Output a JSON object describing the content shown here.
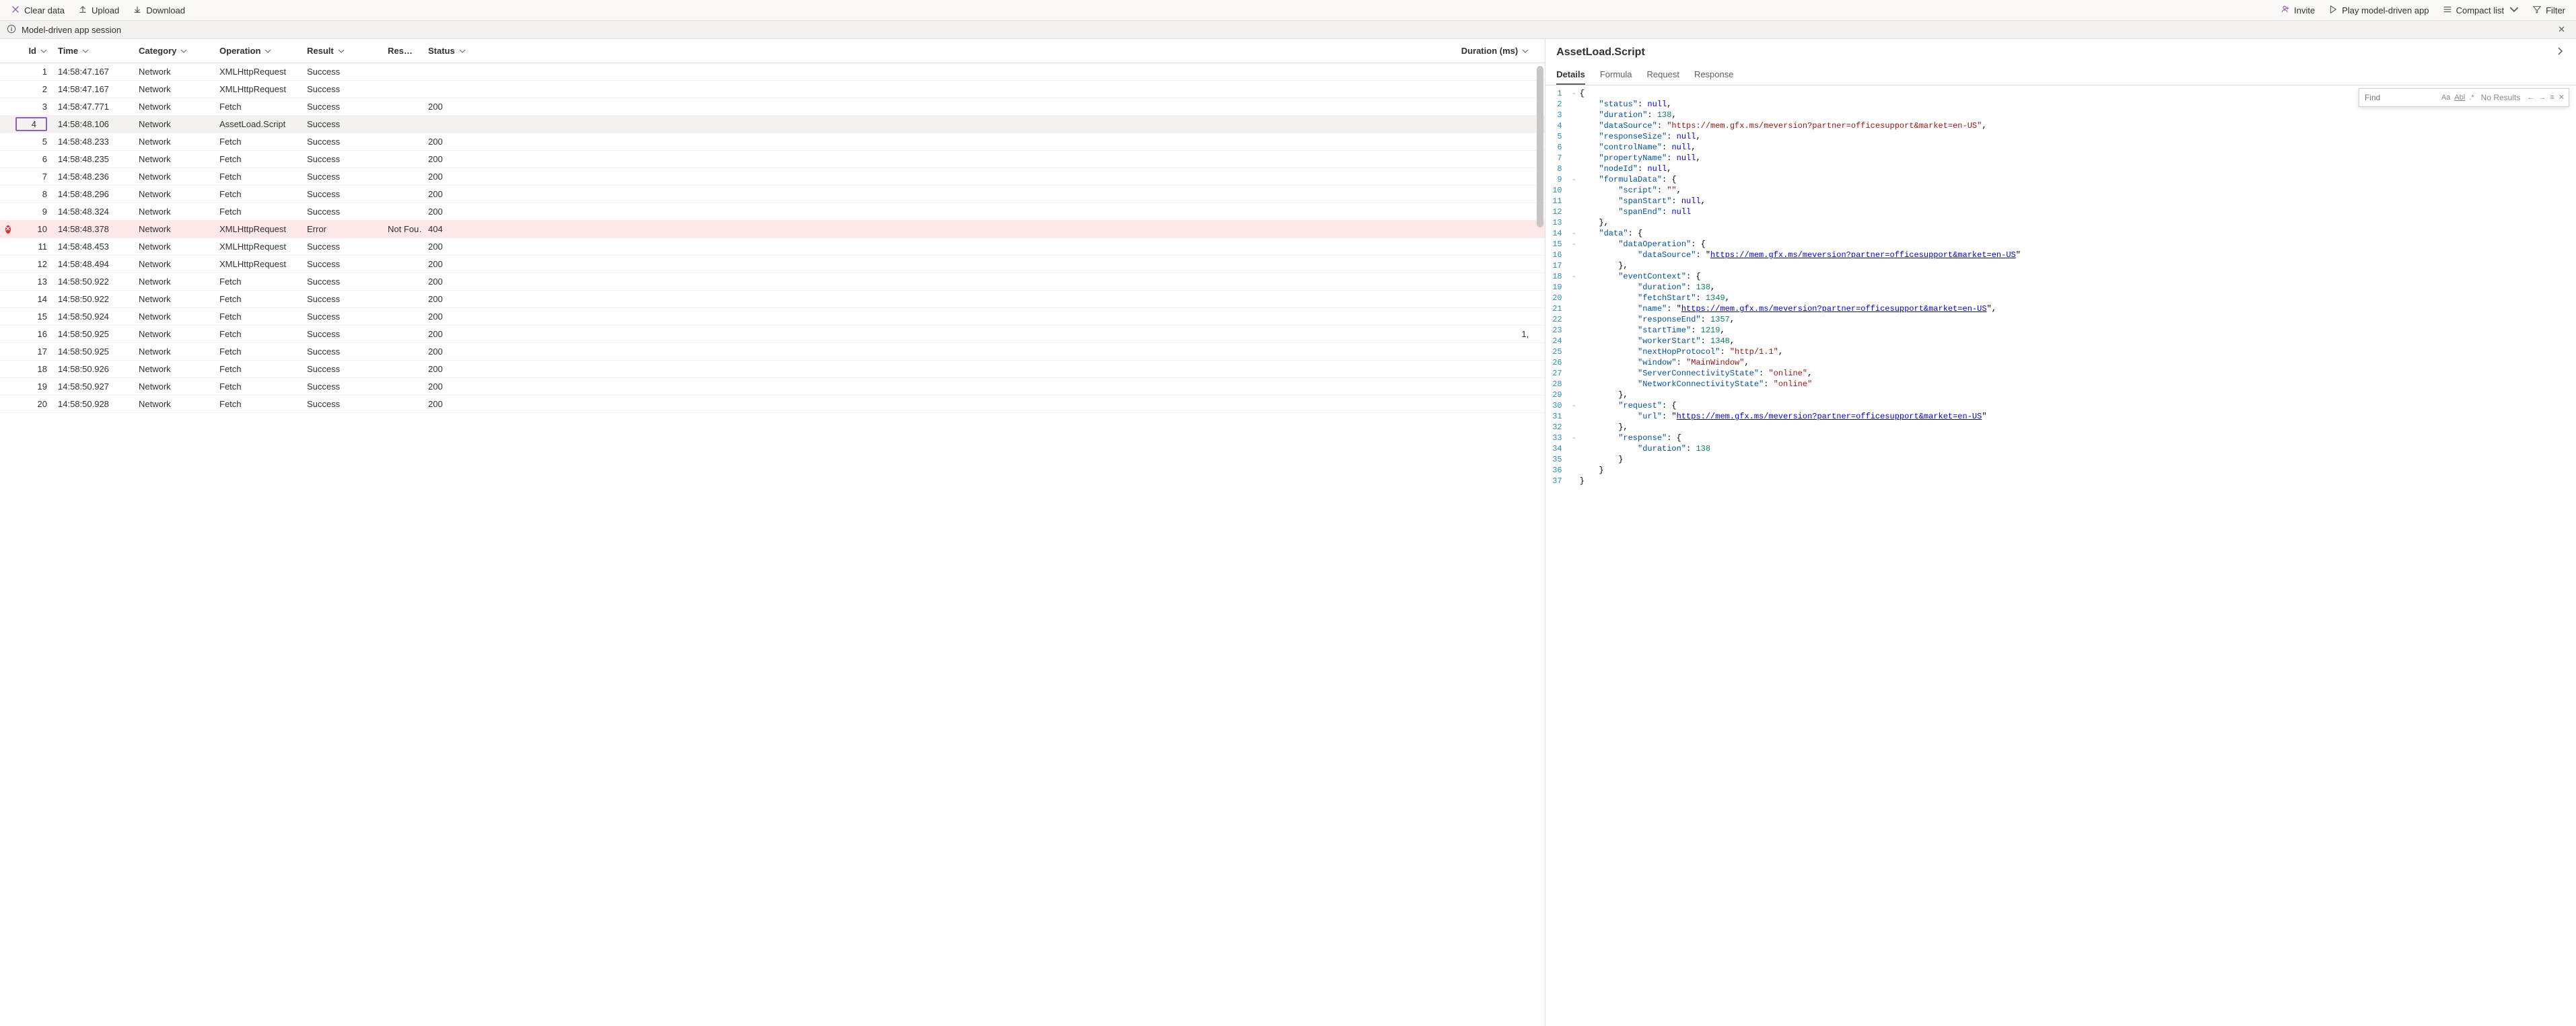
{
  "toolbar": {
    "clear": "Clear data",
    "upload": "Upload",
    "download": "Download",
    "invite": "Invite",
    "play": "Play model-driven app",
    "compact": "Compact list",
    "filter": "Filter"
  },
  "session": {
    "title": "Model-driven app session"
  },
  "columns": {
    "id": "Id",
    "time": "Time",
    "category": "Category",
    "operation": "Operation",
    "result": "Result",
    "res2": "Res…",
    "status": "Status",
    "duration": "Duration (ms)"
  },
  "rows": [
    {
      "id": "1",
      "time": "14:58:47.167",
      "cat": "Network",
      "op": "XMLHttpRequest",
      "res": "Success",
      "res2": "",
      "status": "",
      "dur": "",
      "err": false,
      "sel": false
    },
    {
      "id": "2",
      "time": "14:58:47.167",
      "cat": "Network",
      "op": "XMLHttpRequest",
      "res": "Success",
      "res2": "",
      "status": "",
      "dur": "",
      "err": false,
      "sel": false
    },
    {
      "id": "3",
      "time": "14:58:47.771",
      "cat": "Network",
      "op": "Fetch",
      "res": "Success",
      "res2": "",
      "status": "200",
      "dur": "",
      "err": false,
      "sel": false
    },
    {
      "id": "4",
      "time": "14:58:48.106",
      "cat": "Network",
      "op": "AssetLoad.Script",
      "res": "Success",
      "res2": "",
      "status": "",
      "dur": "",
      "err": false,
      "sel": true
    },
    {
      "id": "5",
      "time": "14:58:48.233",
      "cat": "Network",
      "op": "Fetch",
      "res": "Success",
      "res2": "",
      "status": "200",
      "dur": "",
      "err": false,
      "sel": false
    },
    {
      "id": "6",
      "time": "14:58:48.235",
      "cat": "Network",
      "op": "Fetch",
      "res": "Success",
      "res2": "",
      "status": "200",
      "dur": "",
      "err": false,
      "sel": false
    },
    {
      "id": "7",
      "time": "14:58:48.236",
      "cat": "Network",
      "op": "Fetch",
      "res": "Success",
      "res2": "",
      "status": "200",
      "dur": "",
      "err": false,
      "sel": false
    },
    {
      "id": "8",
      "time": "14:58:48.296",
      "cat": "Network",
      "op": "Fetch",
      "res": "Success",
      "res2": "",
      "status": "200",
      "dur": "",
      "err": false,
      "sel": false
    },
    {
      "id": "9",
      "time": "14:58:48.324",
      "cat": "Network",
      "op": "Fetch",
      "res": "Success",
      "res2": "",
      "status": "200",
      "dur": "",
      "err": false,
      "sel": false
    },
    {
      "id": "10",
      "time": "14:58:48.378",
      "cat": "Network",
      "op": "XMLHttpRequest",
      "res": "Error",
      "res2": "Not Fou…",
      "status": "404",
      "dur": "",
      "err": true,
      "sel": false
    },
    {
      "id": "11",
      "time": "14:58:48.453",
      "cat": "Network",
      "op": "XMLHttpRequest",
      "res": "Success",
      "res2": "",
      "status": "200",
      "dur": "",
      "err": false,
      "sel": false
    },
    {
      "id": "12",
      "time": "14:58:48.494",
      "cat": "Network",
      "op": "XMLHttpRequest",
      "res": "Success",
      "res2": "",
      "status": "200",
      "dur": "",
      "err": false,
      "sel": false
    },
    {
      "id": "13",
      "time": "14:58:50.922",
      "cat": "Network",
      "op": "Fetch",
      "res": "Success",
      "res2": "",
      "status": "200",
      "dur": "",
      "err": false,
      "sel": false
    },
    {
      "id": "14",
      "time": "14:58:50.922",
      "cat": "Network",
      "op": "Fetch",
      "res": "Success",
      "res2": "",
      "status": "200",
      "dur": "",
      "err": false,
      "sel": false
    },
    {
      "id": "15",
      "time": "14:58:50.924",
      "cat": "Network",
      "op": "Fetch",
      "res": "Success",
      "res2": "",
      "status": "200",
      "dur": "",
      "err": false,
      "sel": false
    },
    {
      "id": "16",
      "time": "14:58:50.925",
      "cat": "Network",
      "op": "Fetch",
      "res": "Success",
      "res2": "",
      "status": "200",
      "dur": "1,",
      "err": false,
      "sel": false
    },
    {
      "id": "17",
      "time": "14:58:50.925",
      "cat": "Network",
      "op": "Fetch",
      "res": "Success",
      "res2": "",
      "status": "200",
      "dur": "",
      "err": false,
      "sel": false
    },
    {
      "id": "18",
      "time": "14:58:50.926",
      "cat": "Network",
      "op": "Fetch",
      "res": "Success",
      "res2": "",
      "status": "200",
      "dur": "",
      "err": false,
      "sel": false
    },
    {
      "id": "19",
      "time": "14:58:50.927",
      "cat": "Network",
      "op": "Fetch",
      "res": "Success",
      "res2": "",
      "status": "200",
      "dur": "",
      "err": false,
      "sel": false
    },
    {
      "id": "20",
      "time": "14:58:50.928",
      "cat": "Network",
      "op": "Fetch",
      "res": "Success",
      "res2": "",
      "status": "200",
      "dur": "",
      "err": false,
      "sel": false
    }
  ],
  "detail": {
    "title": "AssetLoad.Script",
    "tabs": [
      "Details",
      "Formula",
      "Request",
      "Response"
    ],
    "activeTab": 0
  },
  "find": {
    "placeholder": "Find",
    "result": "No Results"
  },
  "code": {
    "lines": 37,
    "folds": {
      "1": "-",
      "9": "-",
      "14": "-",
      "15": "-",
      "18": "-",
      "30": "-",
      "33": "-"
    },
    "tokens": [
      [
        [
          "punc",
          "{"
        ]
      ],
      [
        [
          "sp",
          "    "
        ],
        [
          "key",
          "\"status\""
        ],
        [
          "punc",
          ": "
        ],
        [
          "null",
          "null"
        ],
        [
          "punc",
          ","
        ]
      ],
      [
        [
          "sp",
          "    "
        ],
        [
          "key",
          "\"duration\""
        ],
        [
          "punc",
          ": "
        ],
        [
          "num",
          "138"
        ],
        [
          "punc",
          ","
        ]
      ],
      [
        [
          "sp",
          "    "
        ],
        [
          "key",
          "\"dataSource\""
        ],
        [
          "punc",
          ": "
        ],
        [
          "str",
          "\"https://mem.gfx.ms/meversion?partner=officesupport&market=en-US\""
        ],
        [
          "punc",
          ","
        ]
      ],
      [
        [
          "sp",
          "    "
        ],
        [
          "key",
          "\"responseSize\""
        ],
        [
          "punc",
          ": "
        ],
        [
          "null",
          "null"
        ],
        [
          "punc",
          ","
        ]
      ],
      [
        [
          "sp",
          "    "
        ],
        [
          "key",
          "\"controlName\""
        ],
        [
          "punc",
          ": "
        ],
        [
          "null",
          "null"
        ],
        [
          "punc",
          ","
        ]
      ],
      [
        [
          "sp",
          "    "
        ],
        [
          "key",
          "\"propertyName\""
        ],
        [
          "punc",
          ": "
        ],
        [
          "null",
          "null"
        ],
        [
          "punc",
          ","
        ]
      ],
      [
        [
          "sp",
          "    "
        ],
        [
          "key",
          "\"nodeId\""
        ],
        [
          "punc",
          ": "
        ],
        [
          "null",
          "null"
        ],
        [
          "punc",
          ","
        ]
      ],
      [
        [
          "sp",
          "    "
        ],
        [
          "key",
          "\"formulaData\""
        ],
        [
          "punc",
          ": {"
        ]
      ],
      [
        [
          "sp",
          "        "
        ],
        [
          "key",
          "\"script\""
        ],
        [
          "punc",
          ": "
        ],
        [
          "str",
          "\"\""
        ],
        [
          "punc",
          ","
        ]
      ],
      [
        [
          "sp",
          "        "
        ],
        [
          "key",
          "\"spanStart\""
        ],
        [
          "punc",
          ": "
        ],
        [
          "null",
          "null"
        ],
        [
          "punc",
          ","
        ]
      ],
      [
        [
          "sp",
          "        "
        ],
        [
          "key",
          "\"spanEnd\""
        ],
        [
          "punc",
          ": "
        ],
        [
          "null",
          "null"
        ]
      ],
      [
        [
          "sp",
          "    "
        ],
        [
          "punc",
          "},"
        ]
      ],
      [
        [
          "sp",
          "    "
        ],
        [
          "key",
          "\"data\""
        ],
        [
          "punc",
          ": {"
        ]
      ],
      [
        [
          "sp",
          "        "
        ],
        [
          "key",
          "\"dataOperation\""
        ],
        [
          "punc",
          ": {"
        ]
      ],
      [
        [
          "sp",
          "            "
        ],
        [
          "key",
          "\"dataSource\""
        ],
        [
          "punc",
          ": \""
        ],
        [
          "url",
          "https://mem.gfx.ms/meversion?partner=officesupport&market=en-US"
        ],
        [
          "punc",
          "\""
        ]
      ],
      [
        [
          "sp",
          "        "
        ],
        [
          "punc",
          "},"
        ]
      ],
      [
        [
          "sp",
          "        "
        ],
        [
          "key",
          "\"eventContext\""
        ],
        [
          "punc",
          ": {"
        ]
      ],
      [
        [
          "sp",
          "            "
        ],
        [
          "key",
          "\"duration\""
        ],
        [
          "punc",
          ": "
        ],
        [
          "num",
          "138"
        ],
        [
          "punc",
          ","
        ]
      ],
      [
        [
          "sp",
          "            "
        ],
        [
          "key",
          "\"fetchStart\""
        ],
        [
          "punc",
          ": "
        ],
        [
          "num",
          "1349"
        ],
        [
          "punc",
          ","
        ]
      ],
      [
        [
          "sp",
          "            "
        ],
        [
          "key",
          "\"name\""
        ],
        [
          "punc",
          ": \""
        ],
        [
          "url",
          "https://mem.gfx.ms/meversion?partner=officesupport&market=en-US"
        ],
        [
          "punc",
          "\","
        ]
      ],
      [
        [
          "sp",
          "            "
        ],
        [
          "key",
          "\"responseEnd\""
        ],
        [
          "punc",
          ": "
        ],
        [
          "num",
          "1357"
        ],
        [
          "punc",
          ","
        ]
      ],
      [
        [
          "sp",
          "            "
        ],
        [
          "key",
          "\"startTime\""
        ],
        [
          "punc",
          ": "
        ],
        [
          "num",
          "1219"
        ],
        [
          "punc",
          ","
        ]
      ],
      [
        [
          "sp",
          "            "
        ],
        [
          "key",
          "\"workerStart\""
        ],
        [
          "punc",
          ": "
        ],
        [
          "num",
          "1348"
        ],
        [
          "punc",
          ","
        ]
      ],
      [
        [
          "sp",
          "            "
        ],
        [
          "key",
          "\"nextHopProtocol\""
        ],
        [
          "punc",
          ": "
        ],
        [
          "str",
          "\"http/1.1\""
        ],
        [
          "punc",
          ","
        ]
      ],
      [
        [
          "sp",
          "            "
        ],
        [
          "key",
          "\"window\""
        ],
        [
          "punc",
          ": "
        ],
        [
          "str",
          "\"MainWindow\""
        ],
        [
          "punc",
          ","
        ]
      ],
      [
        [
          "sp",
          "            "
        ],
        [
          "key",
          "\"ServerConnectivityState\""
        ],
        [
          "punc",
          ": "
        ],
        [
          "str",
          "\"online\""
        ],
        [
          "punc",
          ","
        ]
      ],
      [
        [
          "sp",
          "            "
        ],
        [
          "key",
          "\"NetworkConnectivityState\""
        ],
        [
          "punc",
          ": "
        ],
        [
          "str",
          "\"online\""
        ]
      ],
      [
        [
          "sp",
          "        "
        ],
        [
          "punc",
          "},"
        ]
      ],
      [
        [
          "sp",
          "        "
        ],
        [
          "key",
          "\"request\""
        ],
        [
          "punc",
          ": {"
        ]
      ],
      [
        [
          "sp",
          "            "
        ],
        [
          "key",
          "\"url\""
        ],
        [
          "punc",
          ": \""
        ],
        [
          "url",
          "https://mem.gfx.ms/meversion?partner=officesupport&market=en-US"
        ],
        [
          "punc",
          "\""
        ]
      ],
      [
        [
          "sp",
          "        "
        ],
        [
          "punc",
          "},"
        ]
      ],
      [
        [
          "sp",
          "        "
        ],
        [
          "key",
          "\"response\""
        ],
        [
          "punc",
          ": {"
        ]
      ],
      [
        [
          "sp",
          "            "
        ],
        [
          "key",
          "\"duration\""
        ],
        [
          "punc",
          ": "
        ],
        [
          "num",
          "138"
        ]
      ],
      [
        [
          "sp",
          "        "
        ],
        [
          "punc",
          "}"
        ]
      ],
      [
        [
          "sp",
          "    "
        ],
        [
          "punc",
          "}"
        ]
      ],
      [
        [
          "punc",
          "}"
        ]
      ]
    ]
  }
}
